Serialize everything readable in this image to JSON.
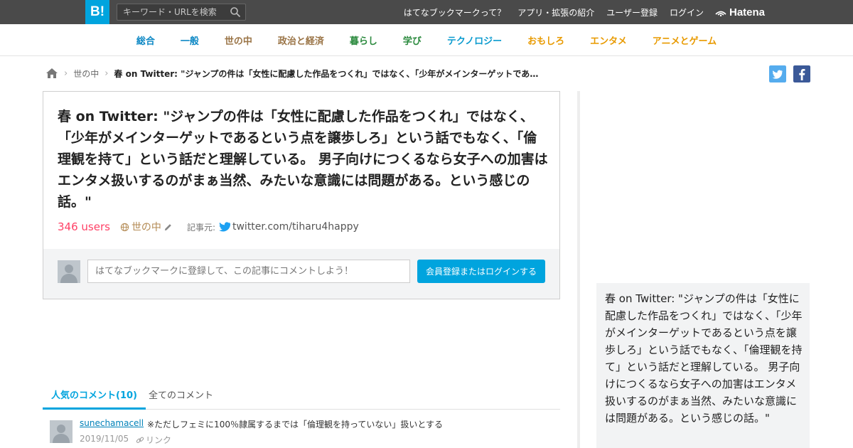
{
  "header": {
    "logo_text": "B!",
    "search_placeholder": "キーワード・URLを検索",
    "nav": [
      "はてなブックマークって？",
      "アプリ・拡張の紹介",
      "ユーザー登録",
      "ログイン"
    ],
    "brand": "Hatena",
    "bg_color": "#4a4a4a",
    "logo_color": "#00a4de"
  },
  "categories": [
    {
      "label": "総合",
      "color": "#0b87c4"
    },
    {
      "label": "一般",
      "color": "#0b87c4"
    },
    {
      "label": "世の中",
      "color": "#9a7446"
    },
    {
      "label": "政治と経済",
      "color": "#9a7446"
    },
    {
      "label": "暮らし",
      "color": "#2b8a3e"
    },
    {
      "label": "学び",
      "color": "#2b8a3e"
    },
    {
      "label": "テクノロジー",
      "color": "#0b9bcf"
    },
    {
      "label": "おもしろ",
      "color": "#e89a00"
    },
    {
      "label": "エンタメ",
      "color": "#e89a00"
    },
    {
      "label": "アニメとゲーム",
      "color": "#e89a00"
    }
  ],
  "breadcrumb": {
    "category": "世の中",
    "current": "春 on Twitter: \"ジャンプの件は「女性に配慮した作品をつくれ」ではなく、「少年がメインターゲットであ…"
  },
  "entry": {
    "title": "春 on Twitter: \"ジャンプの件は「女性に配慮した作品をつくれ」ではなく、「少年がメインターゲットであるという点を譲歩しろ」という話でもなく、「倫理観を持て」という話だと理解している。 男子向けにつくるなら女子への加害はエンタメ扱いするのがまぁ当然、みたいな意識には問題がある。という感じの話。\"",
    "users": "346 users",
    "category": "世の中",
    "source_label": "記事元:",
    "source": "twitter.com/tiharu4happy",
    "comment_placeholder": "はてなブックマークに登録して、この記事にコメントしよう！",
    "login_button": "会員登録またはログインする"
  },
  "summary_box": {
    "text": "春 on Twitter: \"ジャンプの件は「女性に配慮した作品をつくれ」ではなく、「少年がメインターゲットであるという点を譲歩しろ」という話でもなく、「倫理観を持て」という話だと理解している。 男子向けにつくるなら女子への加害はエンタメ扱いするのがまぁ当然、みたいな意識には問題がある。という感じの話。\""
  },
  "comments": {
    "tab_popular": "人気のコメント(10)",
    "tab_all": "全てのコメント",
    "items": [
      {
        "user": "sunechamacell",
        "text": "※ただしフェミに100％隷属するまでは「倫理観を持っていない」扱いとする",
        "date": "2019/11/05",
        "link_label": "リンク"
      }
    ]
  }
}
